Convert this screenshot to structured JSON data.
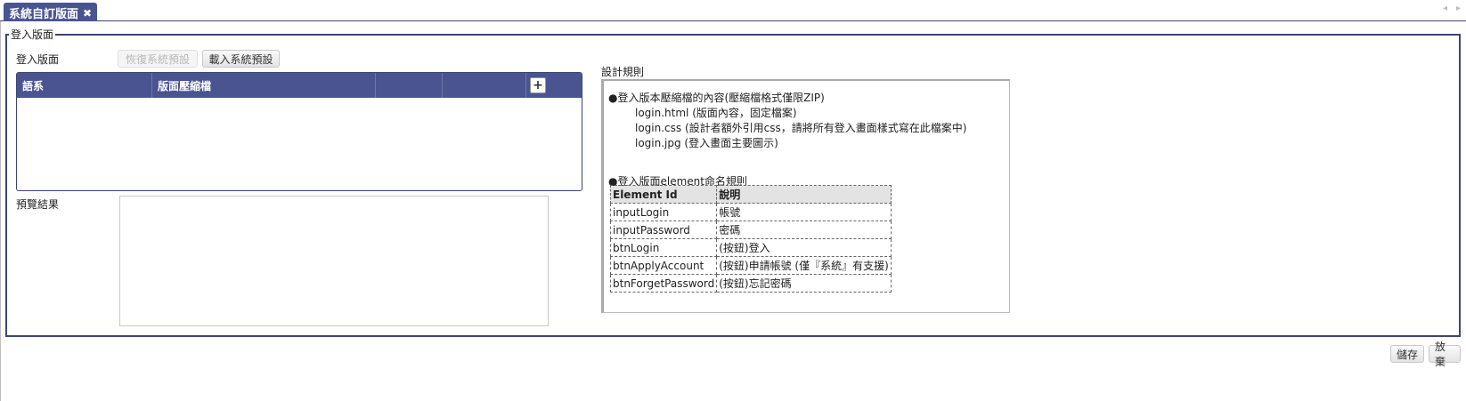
{
  "tab": {
    "title": "系統自訂版面",
    "close": "✖"
  },
  "tab_nav": {
    "prev": "◂",
    "next": "▸"
  },
  "fieldset_legend": "登入版面",
  "login_layout_label": "登入版面",
  "buttons": {
    "restore_default": "恢復系統預設",
    "load_default": "載入系統預設",
    "save": "儲存",
    "discard": "放棄"
  },
  "grid": {
    "columns": [
      "語系",
      "版面壓縮檔",
      "",
      ""
    ],
    "add_label": "+",
    "rows": []
  },
  "preview_label": "預覽結果",
  "rules": {
    "title": "設計規則",
    "zip_heading": "●登入版本壓縮檔的內容(壓縮檔格式僅限ZIP)",
    "files": [
      "login.html (版面內容，固定檔案)",
      "login.css (設計者額外引用css，請將所有登入畫面樣式寫在此檔案中)",
      "login.jpg (登入畫面主要圖示)"
    ],
    "element_heading": "●登入版面element命名規則",
    "table_header": [
      "Element Id",
      "說明"
    ],
    "table_rows": [
      [
        "inputLogin",
        "帳號"
      ],
      [
        "inputPassword",
        "密碼"
      ],
      [
        "btnLogin",
        "(按鈕)登入"
      ],
      [
        "btnApplyAccount",
        "(按鈕)申請帳號 (僅『系統』有支援)"
      ],
      [
        "btnForgetPassword",
        "(按鈕)忘記密碼"
      ]
    ]
  }
}
